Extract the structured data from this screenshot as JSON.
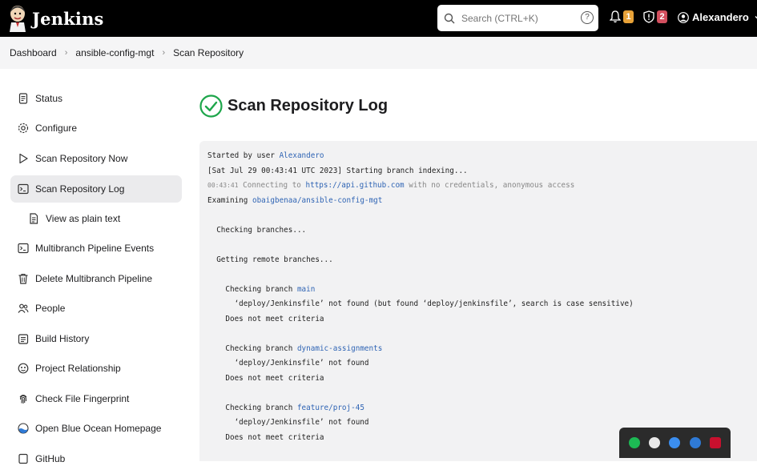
{
  "header": {
    "app_name": "Jenkins",
    "search_placeholder": "Search (CTRL+K)",
    "search_help": "?",
    "notifications_count": "1",
    "security_count": "2",
    "user_name": "Alexandero",
    "colors": {
      "bar": "#000000",
      "notif_badge": "#e8a238",
      "security_badge": "#d24f5e"
    }
  },
  "breadcrumb": [
    "Dashboard",
    "ansible-config-mgt",
    "Scan Repository"
  ],
  "sidebar": {
    "items": [
      {
        "label": "Status",
        "icon": "document-icon"
      },
      {
        "label": "Configure",
        "icon": "gear-icon"
      },
      {
        "label": "Scan Repository Now",
        "icon": "play-icon"
      },
      {
        "label": "Scan Repository Log",
        "icon": "terminal-icon",
        "active": true
      },
      {
        "label": "View as plain text",
        "icon": "document-icon",
        "sub": true
      },
      {
        "label": "Multibranch Pipeline Events",
        "icon": "terminal-icon"
      },
      {
        "label": "Delete Multibranch Pipeline",
        "icon": "trash-icon"
      },
      {
        "label": "People",
        "icon": "people-icon"
      },
      {
        "label": "Build History",
        "icon": "history-icon"
      },
      {
        "label": "Project Relationship",
        "icon": "relationship-icon"
      },
      {
        "label": "Check File Fingerprint",
        "icon": "fingerprint-icon"
      },
      {
        "label": "Open Blue Ocean Homepage",
        "icon": "blue-ocean-icon"
      },
      {
        "label": "GitHub",
        "icon": "github-icon"
      }
    ]
  },
  "main": {
    "title": "Scan Repository Log",
    "log": {
      "started_prefix": "Started by user ",
      "started_user": "Alexandero",
      "indexing": "[Sat Jul 29 00:43:41 UTC 2023] Starting branch indexing...",
      "conn_ts": "00:43:41",
      "conn_prefix": " Connecting to ",
      "conn_url": "https://api.github.com",
      "conn_suffix": " with no credentials, anonymous access",
      "examining_prefix": "Examining ",
      "examining_repo": "obaigbenaa/ansible-config-mgt",
      "checking_branches": "  Checking branches...",
      "getting_remote": "  Getting remote branches...",
      "check_branch_prefix": "    Checking branch ",
      "branch1": "main",
      "branch1_msg": "      ‘deploy/Jenkinsfile’ not found (but found ‘deploy/jenkinsfile’, search is case sensitive)",
      "criteria": "    Does not meet criteria",
      "branch2": "dynamic-assignments",
      "not_found": "      ‘deploy/Jenkinsfile’ not found",
      "branch3": "feature/proj-45"
    }
  },
  "tray": {
    "icons": [
      "spotify-icon",
      "slack-icon",
      "bluetooth-icon",
      "defender-icon",
      "mcafee-icon"
    ],
    "colors": [
      "#1db954",
      "#e8e8e8",
      "#3b8ef0",
      "#2f7ad6",
      "#c8102e"
    ]
  }
}
